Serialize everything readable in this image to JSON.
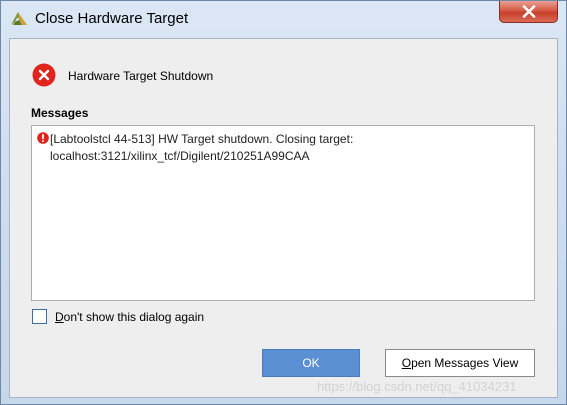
{
  "window": {
    "title": "Close Hardware Target",
    "close_icon": "close-icon",
    "app_icon": "vivado-logo-icon"
  },
  "dialog": {
    "header_icon": "error-icon",
    "header_text": "Hardware Target Shutdown",
    "messages_label": "Messages",
    "messages": [
      {
        "icon": "error-icon",
        "text": "[Labtoolstcl 44-513] HW Target shutdown. Closing target: localhost:3121/xilinx_tcf/Digilent/210251A99CAA"
      }
    ],
    "checkbox": {
      "mnemonic": "D",
      "label_rest": "on't show this dialog again",
      "checked": false
    },
    "buttons": {
      "ok": "OK",
      "open_messages_prefix": "O",
      "open_messages_rest": "pen Messages View"
    }
  },
  "watermark": "https://blog.csdn.net/qq_41034231",
  "colors": {
    "error_red": "#e0241c",
    "ok_button": "#5b8fd3",
    "close_button": "#c7402c"
  }
}
